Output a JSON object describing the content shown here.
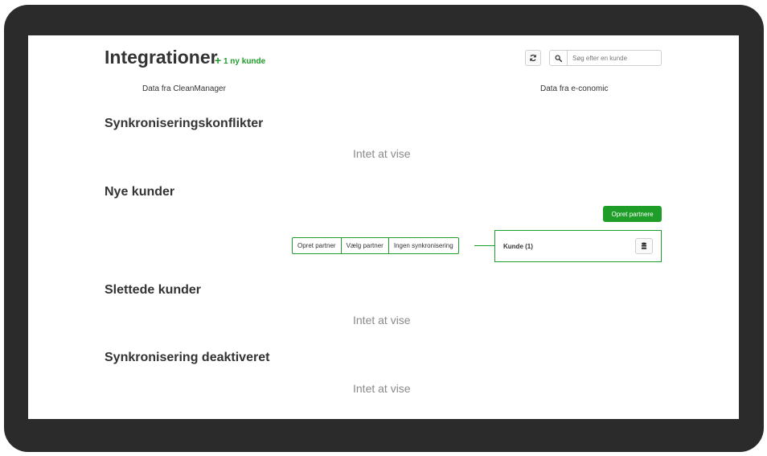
{
  "header": {
    "title": "Integrationer",
    "new_badge_plus": "+",
    "new_badge_text": "1 ny kunde"
  },
  "search": {
    "placeholder": "Søg efter en kunde",
    "value": ""
  },
  "icons": {
    "refresh": "refresh-icon",
    "search": "search-icon",
    "database": "database-icon"
  },
  "columns": {
    "left": "Data fra CleanManager",
    "right": "Data fra e-conomic"
  },
  "sections": {
    "conflicts": {
      "title": "Synkroniseringskonflikter",
      "empty": "Intet at vise"
    },
    "new_customers": {
      "title": "Nye kunder",
      "bulk_action": "Opret partnere",
      "actions": [
        "Opret partner",
        "Vælg partner",
        "Ingen synkronisering"
      ],
      "customer_label": "Kunde (1)"
    },
    "deleted": {
      "title": "Slettede kunder",
      "empty": "Intet at vise"
    },
    "disabled": {
      "title": "Synkronisering deaktiveret",
      "empty": "Intet at vise"
    }
  },
  "colors": {
    "accent": "#1e9e29",
    "bezel": "#2b2b2b",
    "text": "#333333",
    "muted": "#8a8a8a"
  }
}
